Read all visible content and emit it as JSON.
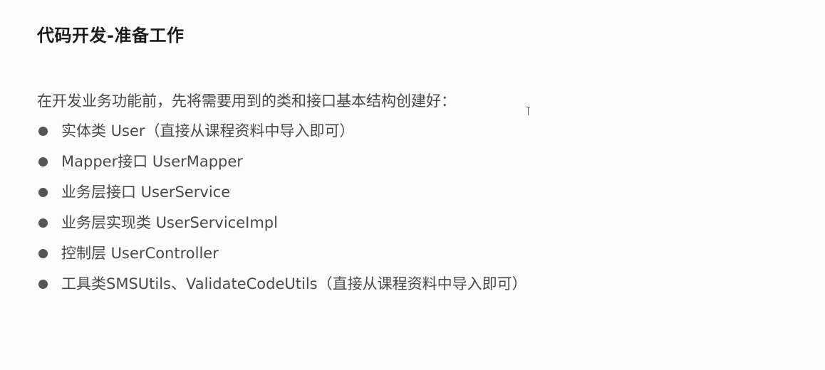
{
  "title": "代码开发-准备工作",
  "intro": "在开发业务功能前，先将需要用到的类和接口基本结构创建好：",
  "items": [
    "实体类 User（直接从课程资料中导入即可）",
    "Mapper接口 UserMapper",
    "业务层接口 UserService",
    "业务层实现类 UserServiceImpl",
    "控制层 UserController",
    "工具类SMSUtils、ValidateCodeUtils（直接从课程资料中导入即可）"
  ],
  "colors": {
    "background": "#fdfcfd",
    "title": "#1a1a1a",
    "text": "#4a4a4a",
    "bullet": "#555555"
  }
}
